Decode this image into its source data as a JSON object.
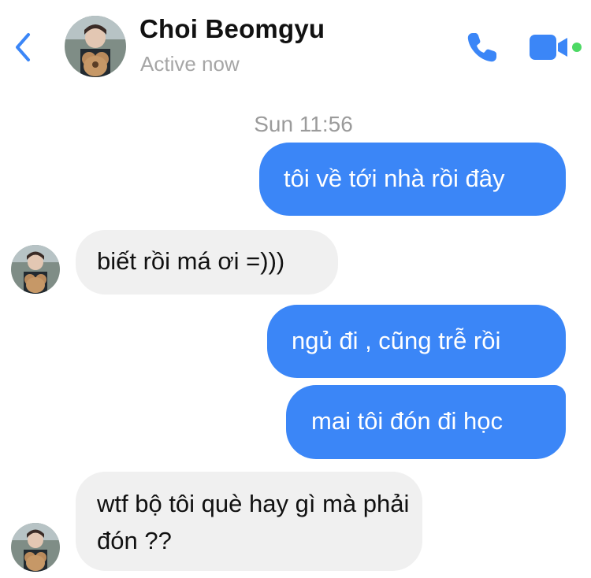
{
  "header": {
    "contact_name": "Choi Beomgyu",
    "status": "Active now",
    "back_icon": "chevron-left-icon",
    "call_icon": "phone-icon",
    "video_icon": "video-camera-icon",
    "online_dot_color": "#4cd964"
  },
  "colors": {
    "accent": "#3b86f7",
    "incoming_bubble": "#f0f0f0"
  },
  "conversation": {
    "timestamp": "Sun 11:56",
    "messages": [
      {
        "direction": "outgoing",
        "text": "tôi về tới nhà rồi đây"
      },
      {
        "direction": "incoming",
        "text": "biết rồi má ơi =)))"
      },
      {
        "direction": "outgoing",
        "text": "ngủ đi , cũng trễ rồi"
      },
      {
        "direction": "outgoing",
        "text": "mai tôi đón đi học"
      },
      {
        "direction": "incoming",
        "text": "wtf bộ tôi què hay gì mà phải đón ??"
      }
    ]
  }
}
